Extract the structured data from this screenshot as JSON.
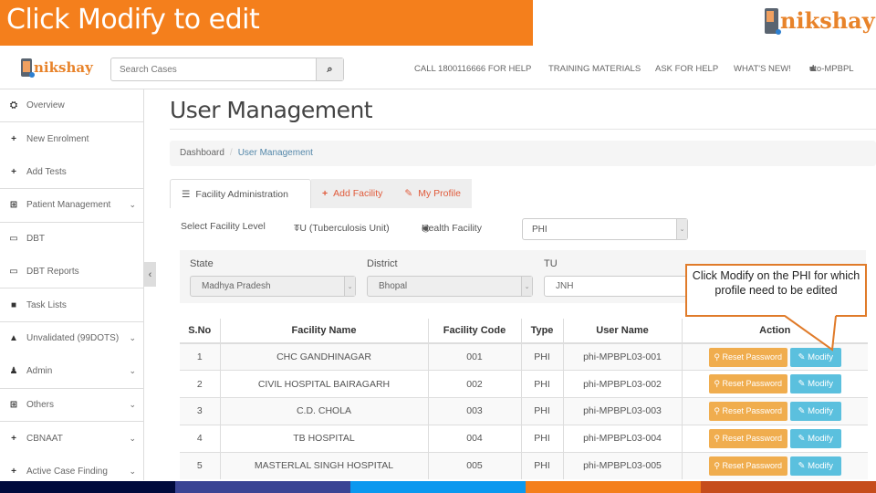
{
  "slide": {
    "title": "Click Modify to edit",
    "logo_text": "nikshay"
  },
  "navbar": {
    "logo_text": "nikshay",
    "search_placeholder": "Search Cases",
    "links": [
      "CALL 1800116666 FOR HELP",
      "TRAINING MATERIALS",
      "ASK FOR HELP",
      "WHAT'S NEW!"
    ],
    "user": "dto-MPBPL"
  },
  "sidebar": {
    "items": [
      {
        "label": "Overview",
        "icon": "dashboard-icon",
        "glyph": "⛭",
        "chevron": false
      },
      {
        "label": "New Enrolment",
        "icon": "plus-icon",
        "glyph": "+",
        "chevron": false
      },
      {
        "label": "Add Tests",
        "icon": "plus-icon",
        "glyph": "+",
        "chevron": false
      },
      {
        "label": "Patient Management",
        "icon": "medkit-icon",
        "glyph": "⊞",
        "chevron": true
      },
      {
        "label": "DBT",
        "icon": "money-icon",
        "glyph": "▭",
        "chevron": false
      },
      {
        "label": "DBT Reports",
        "icon": "money-icon",
        "glyph": "▭",
        "chevron": false
      },
      {
        "label": "Task Lists",
        "icon": "list-icon",
        "glyph": "■",
        "chevron": false
      },
      {
        "label": "Unvalidated (99DOTS)",
        "icon": "warning-icon",
        "glyph": "▲",
        "chevron": true
      },
      {
        "label": "Admin",
        "icon": "user-icon",
        "glyph": "♟",
        "chevron": true
      },
      {
        "label": "Others",
        "icon": "medkit-icon",
        "glyph": "⊞",
        "chevron": true
      },
      {
        "label": "CBNAAT",
        "icon": "plus-icon",
        "glyph": "+",
        "chevron": true
      },
      {
        "label": "Active Case Finding",
        "icon": "plus-icon",
        "glyph": "+",
        "chevron": true
      }
    ]
  },
  "main": {
    "page_title": "User Management",
    "breadcrumb": {
      "home": "Dashboard",
      "separator": "/",
      "current": "User Management"
    },
    "tabs": [
      {
        "label": "Facility Administration",
        "glyph": "☰",
        "active": true
      },
      {
        "label": "Add Facility",
        "glyph": "+",
        "active": false
      },
      {
        "label": "My Profile",
        "glyph": "✎",
        "active": false
      }
    ],
    "facility_level": {
      "label": "Select Facility Level",
      "options": [
        "TU (Tuberculosis Unit)",
        "Health Facility"
      ],
      "selected": "Health Facility",
      "type_value": "PHI"
    },
    "filters": {
      "state_label": "State",
      "state_value": "Madhya Pradesh",
      "district_label": "District",
      "district_value": "Bhopal",
      "tu_label": "TU",
      "tu_value": "JNH"
    },
    "table": {
      "headers": [
        "S.No",
        "Facility Name",
        "Facility Code",
        "Type",
        "User Name",
        "Action"
      ],
      "rows": [
        {
          "sno": "1",
          "name": "CHC GANDHINAGAR",
          "code": "001",
          "type": "PHI",
          "user": "phi-MPBPL03-001"
        },
        {
          "sno": "2",
          "name": "CIVIL HOSPITAL BAIRAGARH",
          "code": "002",
          "type": "PHI",
          "user": "phi-MPBPL03-002"
        },
        {
          "sno": "3",
          "name": "C.D. CHOLA",
          "code": "003",
          "type": "PHI",
          "user": "phi-MPBPL03-003"
        },
        {
          "sno": "4",
          "name": "TB HOSPITAL",
          "code": "004",
          "type": "PHI",
          "user": "phi-MPBPL03-004"
        },
        {
          "sno": "5",
          "name": "MASTERLAL SINGH HOSPITAL",
          "code": "005",
          "type": "PHI",
          "user": "phi-MPBPL03-005"
        }
      ],
      "reset_label": "Reset Password",
      "modify_label": "Modify"
    }
  },
  "callout": {
    "text": "Click Modify on the PHI for which profile need to be edited"
  },
  "colors": {
    "accent_orange": "#f47f1c",
    "reset_button": "#f0ad4e",
    "modify_button": "#5bc0de",
    "stripe": [
      "#000a3c",
      "#3a4494",
      "#0b98ef",
      "#f47f1c",
      "#c64d1c"
    ]
  }
}
